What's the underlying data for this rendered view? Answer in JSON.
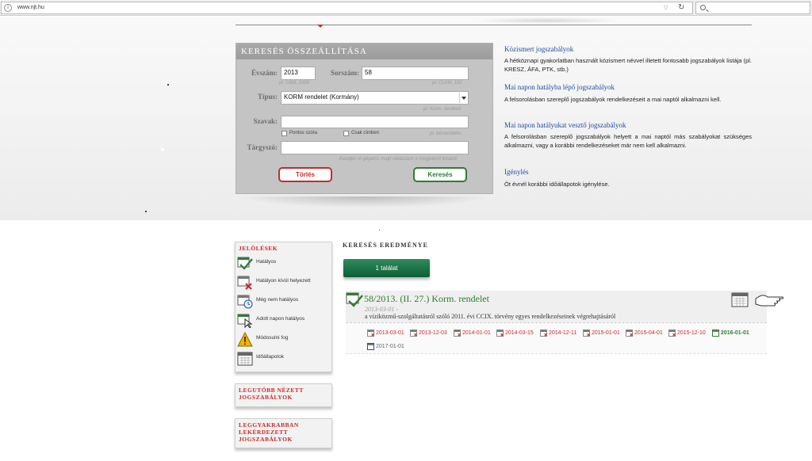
{
  "browser": {
    "url": "www.njt.hu",
    "info_icon": "info-icon",
    "search_icon": "search-icon"
  },
  "search_panel": {
    "title": "KERESÉS ÖSSZEÁLLÍTÁSA",
    "year_label": "Évszám:",
    "year_value": "2013",
    "year_hint": "pl. 1998, 2009",
    "number_label": "Sorszám:",
    "number_value": "58",
    "number_hint": "pl. CLVIII, 102",
    "type_label": "Típus:",
    "type_value": "KORM rendelet (Kormány)",
    "type_hint": "pl. Korm. rendelet",
    "words_label": "Szavak:",
    "words_value": "",
    "exact_label": "Pontos szóra",
    "title_only_label": "Csak címben",
    "words_hint": "pl. bérrendelés",
    "subject_label": "Tárgyszó:",
    "subject_value": "",
    "subject_hint": "Kezdjen el gépelni, majd válasszon a megjelenő listából",
    "clear_button": "Törlés",
    "search_button": "Keresés"
  },
  "right_links": [
    {
      "title": "Közismert jogszabályok",
      "text": "A hétköznapi gyakorlatban használt közismert névvel illetett fontosabb jogszabályok listája (pl. KRESZ, ÁFA, PTK, stb.)"
    },
    {
      "title": "Mai napon hatályba lépő jogszabályok",
      "text": "A felsorolásban szereplő jogszabályok rendelkezéseit a mai naptól alkalmazni kell."
    },
    {
      "title": "Mai napon hatályukat vesztő jogszabályok",
      "text": "A felsorolásban szereplő jogszabályok helyett a mai naptól más szabályokat szükséges alkalmazni, vagy a korábbi rendelkezéseket már nem kell alkalmazni."
    },
    {
      "title": "Igénylés",
      "text": "Öt évnél korábbi időállapotok igénylése."
    }
  ],
  "legend": {
    "title": "JELÖLÉSEK",
    "items": [
      {
        "label": "Hatályos",
        "icon": "in-force-icon"
      },
      {
        "label": "Hatályon kívül helyezett",
        "icon": "repealed-icon"
      },
      {
        "label": "Még nem hatályos",
        "icon": "not-yet-in-force-icon"
      },
      {
        "label": "Adott napon hatályos",
        "icon": "in-force-on-date-icon"
      },
      {
        "label": "Módosulni fog",
        "icon": "warning-icon"
      },
      {
        "label": "Időállapotok",
        "icon": "calendar-icon"
      }
    ]
  },
  "recent_box": {
    "title": "LEGUTÓBB NÉZETT JOGSZABÁLYOK"
  },
  "frequent_box": {
    "title": "LEGGYAKRABBAN LEKÉRDEZETT JOGSZABÁLYOK"
  },
  "results": {
    "title": "KERESÉS EREDMÉNYE",
    "count_label": "1 találat",
    "item": {
      "title": "58/2013. (II. 27.) Korm. rendelet",
      "date": "2013-03-01 -",
      "description": "a víziközmű-szolgáltatásról szóló 2011. évi CCIX. törvény egyes rendelkezéseinek végrehajtásáról",
      "states": [
        {
          "date": "2013-03-01",
          "status": "repealed"
        },
        {
          "date": "2013-12-03",
          "status": "repealed"
        },
        {
          "date": "2014-01-01",
          "status": "repealed"
        },
        {
          "date": "2014-03-15",
          "status": "repealed"
        },
        {
          "date": "2014-12-11",
          "status": "repealed"
        },
        {
          "date": "2015-01-01",
          "status": "repealed"
        },
        {
          "date": "2015-04-01",
          "status": "repealed"
        },
        {
          "date": "2015-12-10",
          "status": "repealed"
        },
        {
          "date": "2016-01-01",
          "status": "current"
        },
        {
          "date": "2017-01-01",
          "status": "future"
        }
      ]
    }
  },
  "colors": {
    "accent_red": "#c62a2a",
    "accent_green": "#2e7d32",
    "link_blue": "#1e4fa0",
    "panel_gray": "#c4c4c4"
  }
}
